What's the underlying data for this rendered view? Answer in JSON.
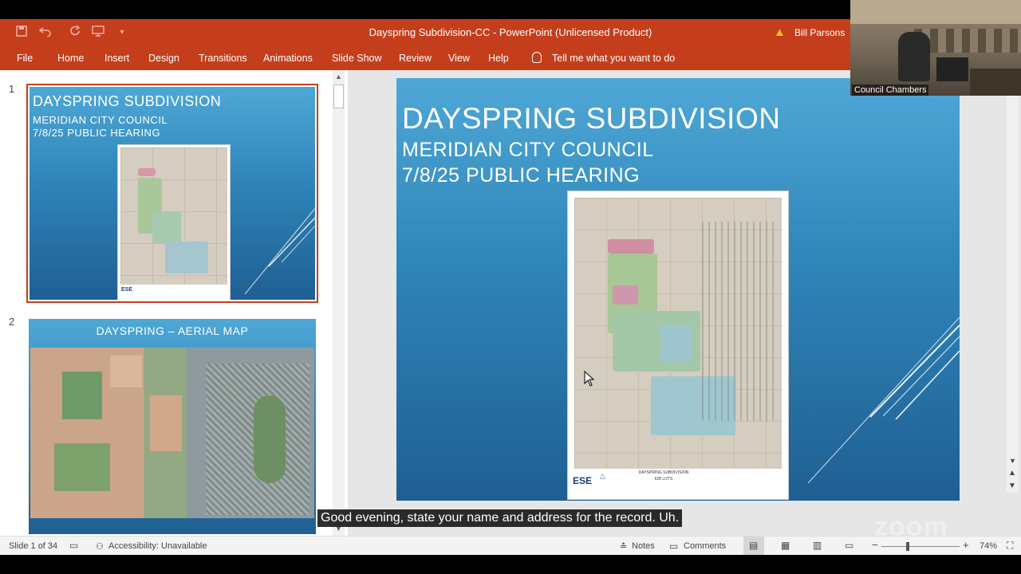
{
  "window": {
    "title": "Dayspring Subdivision-CC  -  PowerPoint (Unlicensed Product)",
    "user": "Bill Parsons"
  },
  "ribbon": {
    "tabs": [
      "File",
      "Home",
      "Insert",
      "Design",
      "Transitions",
      "Animations",
      "Slide Show",
      "Review",
      "View",
      "Help"
    ],
    "tell_me": "Tell me what you want to do"
  },
  "thumbnails": [
    {
      "number": "1",
      "title": "DAYSPRING SUBDIVISION",
      "subtitle1": "MERIDIAN CITY COUNCIL",
      "subtitle2": "7/8/25 PUBLIC HEARING"
    },
    {
      "number": "2",
      "title": "DAYSPRING – AERIAL MAP"
    }
  ],
  "slide": {
    "title": "DAYSPRING SUBDIVISION",
    "subtitle1": "MERIDIAN CITY COUNCIL",
    "subtitle2": "7/8/25 PUBLIC HEARING",
    "plan_logo": "ESE",
    "plan_heading": "DAYSPRING SUBDIVISION",
    "plan_lots": "528 LOTS"
  },
  "caption": "Good evening, state your name and address for the record. Uh.",
  "status": {
    "slide_count": "Slide 1 of 34",
    "accessibility": "Accessibility: Unavailable",
    "notes": "Notes",
    "comments": "Comments",
    "zoom": "74%"
  },
  "video": {
    "label": "Council Chambers",
    "watermark": "zoom"
  },
  "colors": {
    "ribbon": "#c43e1c",
    "slide_gradient_top": "#4ea8d6",
    "slide_gradient_bottom": "#1f5f93"
  }
}
